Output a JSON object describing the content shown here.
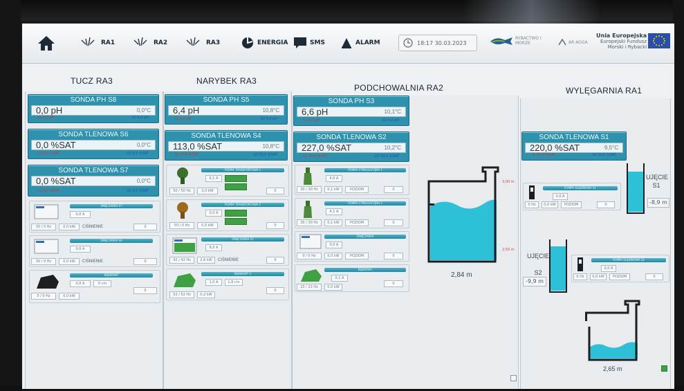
{
  "toolbar": {
    "home_icon": "home-icon",
    "nav": [
      {
        "label": "RA1",
        "icon": "pump-icon"
      },
      {
        "label": "RA2",
        "icon": "pump-icon"
      },
      {
        "label": "RA3",
        "icon": "pump-icon"
      },
      {
        "label": "ENERGIA",
        "icon": "energy-icon"
      },
      {
        "label": "SMS",
        "icon": "message-icon"
      },
      {
        "label": "ALARM",
        "icon": "alarm-icon"
      }
    ],
    "datetime": "18:17 30.03.2023",
    "logo1": "RYBACTWO I MORZE",
    "logo2": "AR AGGA",
    "eu_title": "Unia Europejska",
    "eu_line1": "Europejski Fundusz",
    "eu_line2": "Morski i Rybacki"
  },
  "sections": {
    "tucz": "TUCZ RA3",
    "narybek": "NARYBEK RA3",
    "podchowalnia": "PODCHOWALNIA RA2",
    "wylegarnia": "WYLĘGARNIA RA1"
  },
  "tucz": {
    "sonda_ph": {
      "title": "SONDA PH S8",
      "value": "0,0 pH",
      "temp": "0,0°C",
      "lo": "LL 0,0 pH",
      "hi": "LO 0,0 pH"
    },
    "sonda_tlen1": {
      "title": "SONDA TLENOWA S6",
      "value": "0,0 %SAT",
      "temp": "0,0°C",
      "lo": "LL 0,0 %SAT",
      "hi": "LO 0,0 %SAT"
    },
    "sonda_tlen2": {
      "title": "SONDA TLENOWA S7",
      "value": "0,0 %SAT",
      "temp": "0,0°C",
      "lo": "LL 0,0 %SAT",
      "hi": "LO 0,0 %SAT"
    },
    "dev1": {
      "current": "0,0 A",
      "freq": "30 / 0 Hz",
      "power": "0,0 kW",
      "mode": "CIŚNIENIE",
      "set": "0"
    },
    "dev2": {
      "current": "0,0 A",
      "freq": "30 / 0 Hz",
      "power": "0,0 kW",
      "mode": "CIŚNIENIE",
      "set": "0"
    },
    "dev3": {
      "current": "0,0 A",
      "level": "0 cm",
      "freq": "0 / 0 Hz",
      "power": "0,0 kW",
      "set": "0"
    }
  },
  "narybek": {
    "sonda_ph": {
      "title": "SONDA PH S5",
      "value": "6,4 pH",
      "temp": "10,8°C",
      "lo": "LL 0,0 pH",
      "hi": "LO 0,0 pH"
    },
    "sonda_tlen": {
      "title": "SONDA TLENOWA S4",
      "value": "113,0 %SAT",
      "temp": "10,8°C",
      "lo": "LL 70,0 %SAT",
      "hi": "LO 50,0 %SAT"
    },
    "dev1": {
      "current": "6,1 A",
      "freq": "50 / 50 Hz",
      "power": "3,0 kW",
      "set": "0"
    },
    "dev2": {
      "current": "0,0 A",
      "freq": "50 / 0 Hz",
      "power": "0,0 kW",
      "set": "0"
    },
    "dev3": {
      "current": "6,0 A",
      "freq": "42 / 42 Hz",
      "power": "2,6 kW",
      "mode": "CIŚNIENIE",
      "set": "0"
    },
    "dev4": {
      "current": "1,0 A",
      "level": "1,8 cm",
      "freq": "52 / 52 Hz",
      "power": "0,2 kW",
      "set": "0"
    }
  },
  "podchowalnia": {
    "sonda_ph": {
      "title": "SONDA PH S3",
      "value": "6,6 pH",
      "temp": "10,1°C",
      "lo": "LL 0,0 pH",
      "hi": "LO 0,0 pH"
    },
    "sonda_tlen": {
      "title": "SONDA TLENOWA S2",
      "value": "227,0 %SAT",
      "temp": "10,2°C",
      "lo": "LL 70,0 %SAT",
      "hi": "LO 50,0 %SAT"
    },
    "dev1": {
      "current": "4,0 A",
      "freq": "30 / 30 Hz",
      "power": "0,1 kW",
      "mode": "POZIOM",
      "set": "0"
    },
    "dev2": {
      "current": "4,1 A",
      "freq": "30 / 30 Hz",
      "power": "0,1 kW",
      "mode": "POZIOM",
      "set": "0"
    },
    "dev3": {
      "current": "0,0 A",
      "freq": "0 / 0 Hz",
      "power": "0,0 kW",
      "mode": "POZIOM",
      "set": "0"
    },
    "dev4": {
      "current": "0,1 A",
      "freq": "23 / 23 Hz",
      "power": "0,0 kW",
      "set": "0"
    },
    "tank_level": "2,84 m",
    "tank_mark_top": "3,00 m",
    "tank_mark_bottom": "2,50 m"
  },
  "wylegarnia": {
    "sonda_tlen": {
      "title": "SONDA TLENOWA S1",
      "value": "220,0 %SAT",
      "temp": "9,5°C",
      "lo": "LL 70,0 %SAT",
      "hi": "LO 50,0 %SAT"
    },
    "ujecie1_label1": "UJĘCIE",
    "ujecie1_label2": "S1",
    "ujecie1_value": "-8,9 m",
    "ujecie2_label1": "UJĘCIE",
    "ujecie2_label2": "S2",
    "ujecie2_value": "-9,9 m",
    "dev1": {
      "current": "0,0 A",
      "freq": "0 Hz",
      "power": "0,0 kW",
      "mode": "POZIOM",
      "set": "0"
    },
    "dev2": {
      "current": "0,0 A",
      "freq": "0 Hz",
      "power": "0,0 kW",
      "mode": "POZIOM",
      "set": "0"
    },
    "tank_level": "2,65 m"
  },
  "colors": {
    "tile": "#2e92ae",
    "water": "#2ec0d6",
    "green": "#3fa044"
  }
}
